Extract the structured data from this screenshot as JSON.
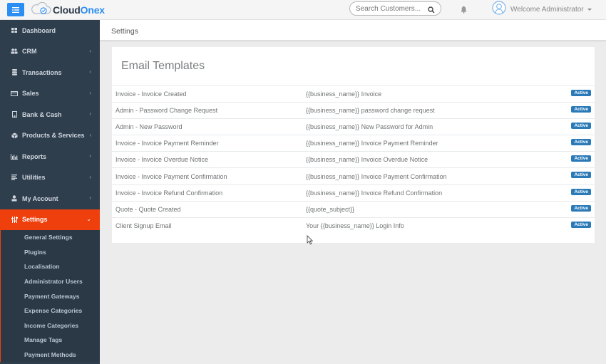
{
  "app": {
    "brand_prefix": "Cloud",
    "brand_suffix": "Onex",
    "accent_color": "#2c8ef2",
    "active_nav_color": "#ee3f0d"
  },
  "topbar": {
    "search_placeholder": "Search Customers...",
    "search_icon": "search-icon",
    "notification_icon": "bell-icon",
    "user_label": "Welcome Administrator",
    "avatar_icon": "user-circle-icon"
  },
  "sidebar": {
    "items": [
      {
        "label": "Dashboard",
        "icon": "grid-icon",
        "has_children": false
      },
      {
        "label": "CRM",
        "icon": "users-icon",
        "has_children": true
      },
      {
        "label": "Transactions",
        "icon": "database-icon",
        "has_children": true
      },
      {
        "label": "Sales",
        "icon": "credit-card-icon",
        "has_children": true
      },
      {
        "label": "Bank & Cash",
        "icon": "building-icon",
        "has_children": true
      },
      {
        "label": "Products & Services",
        "icon": "cube-icon",
        "has_children": true
      },
      {
        "label": "Reports",
        "icon": "bar-chart-icon",
        "has_children": true
      },
      {
        "label": "Utilities",
        "icon": "list-icon",
        "has_children": true
      },
      {
        "label": "My Account",
        "icon": "user-icon",
        "has_children": true
      },
      {
        "label": "Settings",
        "icon": "sliders-icon",
        "has_children": true,
        "active": true
      }
    ],
    "settings_submenu": [
      "General Settings",
      "Plugins",
      "Localisation",
      "Administrator Users",
      "Payment Gateways",
      "Expense Categories",
      "Income Categories",
      "Manage Tags",
      "Payment Methods"
    ]
  },
  "page": {
    "header_title": "Settings",
    "card_title": "Email Templates"
  },
  "templates": [
    {
      "name": "Invoice - Invoice Created",
      "subject": "{{business_name}} Invoice",
      "status": "Active"
    },
    {
      "name": "Admin - Password Change Request",
      "subject": "{{business_name}} password change request",
      "status": "Active"
    },
    {
      "name": "Admin - New Password",
      "subject": "{{business_name}} New Password for Admin",
      "status": "Active"
    },
    {
      "name": "Invoice - Invoice Payment Reminder",
      "subject": "{{business_name}} Invoice Payment Reminder",
      "status": "Active"
    },
    {
      "name": "Invoice - Invoice Overdue Notice",
      "subject": "{{business_name}} Invoice Overdue Notice",
      "status": "Active"
    },
    {
      "name": "Invoice - Invoice Payment Confirmation",
      "subject": "{{business_name}} Invoice Payment Confirmation",
      "status": "Active"
    },
    {
      "name": "Invoice - Invoice Refund Confirmation",
      "subject": "{{business_name}} Invoice Refund Confirmation",
      "status": "Active"
    },
    {
      "name": "Quote - Quote Created",
      "subject": "{{quote_subject}}",
      "status": "Active"
    },
    {
      "name": "Client Signup Email",
      "subject": "Your {{business_name}} Login Info",
      "status": "Active"
    }
  ]
}
